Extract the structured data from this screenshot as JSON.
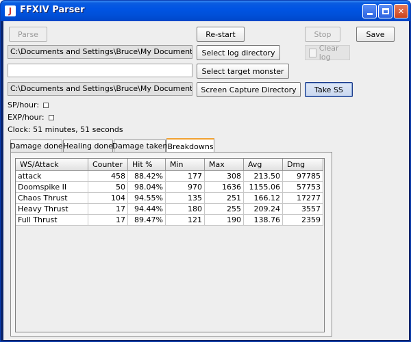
{
  "window": {
    "title": "FFXIV Parser",
    "icon_glyph": "J"
  },
  "toolbar": {
    "parse_label": "Parse",
    "restart_label": "Re-start",
    "stop_label": "Stop",
    "save_label": "Save",
    "select_log_label": "Select log directory",
    "clear_log_label": "Clear log",
    "select_target_label": "Select target monster",
    "screen_capture_label": "Screen Capture Directory",
    "take_ss_label": "Take SS"
  },
  "fields": {
    "log_directory": "C:\\Documents and Settings\\Bruce\\My Documents\\My G",
    "target_monster": "",
    "capture_directory": "C:\\Documents and Settings\\Bruce\\My Documents"
  },
  "stats": {
    "sp_label": "SP/hour:",
    "exp_label": "EXP/hour:",
    "clock": "Clock: 51 minutes, 51 seconds"
  },
  "tabs": [
    {
      "label": "Damage done"
    },
    {
      "label": "Healing done"
    },
    {
      "label": "Damage taken"
    },
    {
      "label": "Breakdowns"
    }
  ],
  "table": {
    "columns": [
      "WS/Attack",
      "Counter",
      "Hit %",
      "Min",
      "Max",
      "Avg",
      "Dmg"
    ],
    "rows": [
      [
        "attack",
        "458",
        "88.42%",
        "177",
        "308",
        "213.50",
        "97785"
      ],
      [
        "Doomspike II",
        "50",
        "98.04%",
        "970",
        "1636",
        "1155.06",
        "57753"
      ],
      [
        "Chaos Thrust",
        "104",
        "94.55%",
        "135",
        "251",
        "166.12",
        "17277"
      ],
      [
        "Heavy Thrust",
        "17",
        "94.44%",
        "180",
        "255",
        "209.24",
        "3557"
      ],
      [
        "Full Thrust",
        "17",
        "89.47%",
        "121",
        "190",
        "138.76",
        "2359"
      ]
    ]
  },
  "colors": {
    "titlebar": "#0054e3",
    "active_tab_accent": "#f0a030",
    "close_button": "#c9431d"
  }
}
